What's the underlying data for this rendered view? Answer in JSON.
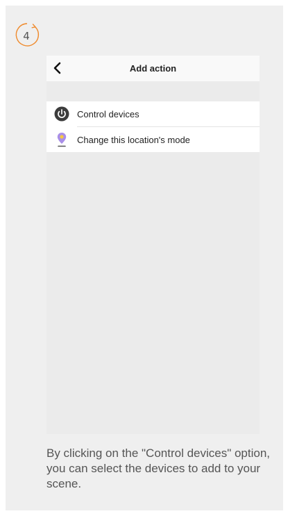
{
  "step": {
    "number": "4",
    "accent_color": "#ef8a2c"
  },
  "screen": {
    "title": "Add action",
    "back_icon": "chevron-left-icon",
    "items": [
      {
        "label": "Control devices",
        "icon": "power-icon",
        "icon_color": "#3c3c3c"
      },
      {
        "label": "Change this location's mode",
        "icon": "location-pin-icon",
        "icon_color": "#a98fe8"
      }
    ]
  },
  "caption": "By clicking on the \"Control devices\" option, you can select the devices to add to your scene."
}
